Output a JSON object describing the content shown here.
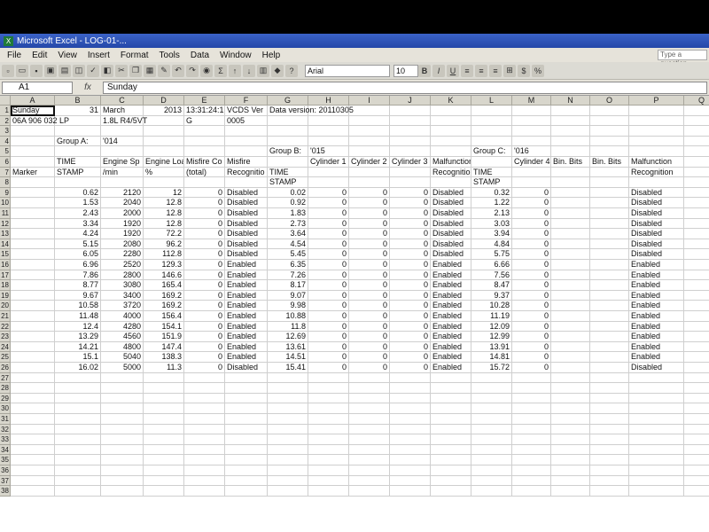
{
  "window": {
    "title": "Microsoft Excel - LOG-01-..."
  },
  "menu": [
    "File",
    "Edit",
    "View",
    "Insert",
    "Format",
    "Tools",
    "Data",
    "Window",
    "Help"
  ],
  "ask_box": "Type a question",
  "toolbar": {
    "font": "Arial",
    "size": "10",
    "bold": "B",
    "italic": "I",
    "underline": "U",
    "sigma": "Σ",
    "percent": "%"
  },
  "formula_bar": {
    "name_box": "A1",
    "fx": "fx",
    "content": "Sunday"
  },
  "columns": [
    "A",
    "B",
    "C",
    "D",
    "E",
    "F",
    "G",
    "H",
    "I",
    "J",
    "K",
    "L",
    "M",
    "N",
    "O",
    "P",
    "Q"
  ],
  "rows": [
    "1",
    "2",
    "3",
    "4",
    "5",
    "6",
    "7",
    "8",
    "9",
    "10",
    "11",
    "12",
    "13",
    "14",
    "15",
    "16",
    "17",
    "18",
    "19",
    "20",
    "21",
    "22",
    "23",
    "24",
    "25",
    "26",
    "27",
    "28",
    "29",
    "30",
    "31",
    "32",
    "33",
    "34",
    "35",
    "36",
    "37",
    "38"
  ],
  "header_rows": [
    [
      "Sunday",
      "31",
      "March",
      "2013",
      "13:31:24:1",
      "VCDS Ver",
      "Data version: 20110305",
      "",
      "",
      "",
      "",
      "",
      "",
      "",
      "",
      "",
      ""
    ],
    [
      "06A 906 032 LP",
      "",
      "1.8L R4/5VT",
      "",
      "G",
      "0005",
      "",
      "",
      "",
      "",
      "",
      "",
      "",
      "",
      "",
      "",
      ""
    ],
    [
      "",
      "",
      "",
      "",
      "",
      "",
      "",
      "",
      "",
      "",
      "",
      "",
      "",
      "",
      "",
      "",
      ""
    ],
    [
      "",
      "Group A:",
      "'014",
      "",
      "",
      "",
      "",
      "",
      "",
      "",
      "",
      "",
      "",
      "",
      "",
      "",
      ""
    ],
    [
      "",
      "",
      "",
      "",
      "",
      "",
      "Group B:",
      "'015",
      "",
      "",
      "",
      "Group C:",
      "'016",
      "",
      "",
      "",
      ""
    ],
    [
      "",
      "TIME",
      "Engine Sp",
      "Engine Loa",
      "Misfire Co",
      "Misfire",
      "",
      "Cylinder 1",
      "Cylinder 2",
      "Cylinder 3",
      "Malfunction",
      "",
      "Cylinder 4",
      "Bin. Bits",
      "Bin. Bits",
      "Malfunction",
      ""
    ],
    [
      "Marker",
      "STAMP",
      "/min",
      "%",
      "(total)",
      "Recognitio",
      "TIME",
      "",
      "",
      "",
      "Recognitio",
      "TIME",
      "",
      "",
      "",
      "Recognition",
      ""
    ],
    [
      "",
      "",
      "",
      "",
      "",
      "",
      "STAMP",
      "",
      "",
      "",
      "",
      "STAMP",
      "",
      "",
      "",
      "",
      ""
    ]
  ],
  "data_rows": [
    [
      "",
      "0.62",
      "2120",
      "12",
      "0",
      "Disabled",
      "0.02",
      "0",
      "0",
      "0",
      "Disabled",
      "0.32",
      "0",
      "",
      "",
      "Disabled",
      ""
    ],
    [
      "",
      "1.53",
      "2040",
      "12.8",
      "0",
      "Disabled",
      "0.92",
      "0",
      "0",
      "0",
      "Disabled",
      "1.22",
      "0",
      "",
      "",
      "Disabled",
      ""
    ],
    [
      "",
      "2.43",
      "2000",
      "12.8",
      "0",
      "Disabled",
      "1.83",
      "0",
      "0",
      "0",
      "Disabled",
      "2.13",
      "0",
      "",
      "",
      "Disabled",
      ""
    ],
    [
      "",
      "3.34",
      "1920",
      "12.8",
      "0",
      "Disabled",
      "2.73",
      "0",
      "0",
      "0",
      "Disabled",
      "3.03",
      "0",
      "",
      "",
      "Disabled",
      ""
    ],
    [
      "",
      "4.24",
      "1920",
      "72.2",
      "0",
      "Disabled",
      "3.64",
      "0",
      "0",
      "0",
      "Disabled",
      "3.94",
      "0",
      "",
      "",
      "Disabled",
      ""
    ],
    [
      "",
      "5.15",
      "2080",
      "96.2",
      "0",
      "Disabled",
      "4.54",
      "0",
      "0",
      "0",
      "Disabled",
      "4.84",
      "0",
      "",
      "",
      "Disabled",
      ""
    ],
    [
      "",
      "6.05",
      "2280",
      "112.8",
      "0",
      "Disabled",
      "5.45",
      "0",
      "0",
      "0",
      "Disabled",
      "5.75",
      "0",
      "",
      "",
      "Disabled",
      ""
    ],
    [
      "",
      "6.96",
      "2520",
      "129.3",
      "0",
      "Enabled",
      "6.35",
      "0",
      "0",
      "0",
      "Enabled",
      "6.66",
      "0",
      "",
      "",
      "Enabled",
      ""
    ],
    [
      "",
      "7.86",
      "2800",
      "146.6",
      "0",
      "Enabled",
      "7.26",
      "0",
      "0",
      "0",
      "Enabled",
      "7.56",
      "0",
      "",
      "",
      "Enabled",
      ""
    ],
    [
      "",
      "8.77",
      "3080",
      "165.4",
      "0",
      "Enabled",
      "8.17",
      "0",
      "0",
      "0",
      "Enabled",
      "8.47",
      "0",
      "",
      "",
      "Enabled",
      ""
    ],
    [
      "",
      "9.67",
      "3400",
      "169.2",
      "0",
      "Enabled",
      "9.07",
      "0",
      "0",
      "0",
      "Enabled",
      "9.37",
      "0",
      "",
      "",
      "Enabled",
      ""
    ],
    [
      "",
      "10.58",
      "3720",
      "169.2",
      "0",
      "Enabled",
      "9.98",
      "0",
      "0",
      "0",
      "Enabled",
      "10.28",
      "0",
      "",
      "",
      "Enabled",
      ""
    ],
    [
      "",
      "11.48",
      "4000",
      "156.4",
      "0",
      "Enabled",
      "10.88",
      "0",
      "0",
      "0",
      "Enabled",
      "11.19",
      "0",
      "",
      "",
      "Enabled",
      ""
    ],
    [
      "",
      "12.4",
      "4280",
      "154.1",
      "0",
      "Enabled",
      "11.8",
      "0",
      "0",
      "0",
      "Enabled",
      "12.09",
      "0",
      "",
      "",
      "Enabled",
      ""
    ],
    [
      "",
      "13.29",
      "4560",
      "151.9",
      "0",
      "Enabled",
      "12.69",
      "0",
      "0",
      "0",
      "Enabled",
      "12.99",
      "0",
      "",
      "",
      "Enabled",
      ""
    ],
    [
      "",
      "14.21",
      "4800",
      "147.4",
      "0",
      "Enabled",
      "13.61",
      "0",
      "0",
      "0",
      "Enabled",
      "13.91",
      "0",
      "",
      "",
      "Enabled",
      ""
    ],
    [
      "",
      "15.1",
      "5040",
      "138.3",
      "0",
      "Enabled",
      "14.51",
      "0",
      "0",
      "0",
      "Enabled",
      "14.81",
      "0",
      "",
      "",
      "Enabled",
      ""
    ],
    [
      "",
      "16.02",
      "5000",
      "11.3",
      "0",
      "Disabled",
      "15.41",
      "0",
      "0",
      "0",
      "Enabled",
      "15.72",
      "0",
      "",
      "",
      "Disabled",
      ""
    ]
  ]
}
